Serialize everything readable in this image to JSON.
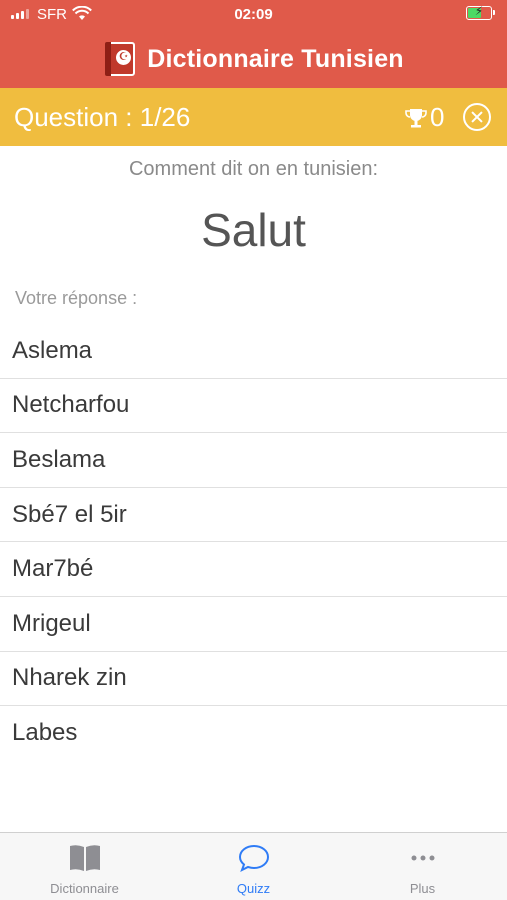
{
  "status_bar": {
    "carrier": "SFR",
    "time": "02:09"
  },
  "header": {
    "title": "Dictionnaire Tunisien",
    "icon": "app-book-flag-icon"
  },
  "question_bar": {
    "label": "Question : 1/26",
    "score": "0",
    "score_icon": "trophy-icon",
    "close_icon": "close-circle-icon"
  },
  "quiz": {
    "prompt": "Comment dit on en tunisien:",
    "word": "Salut",
    "answer_label": "Votre réponse :",
    "options": [
      "Aslema",
      "Netcharfou",
      "Beslama",
      "Sbé7 el 5ir",
      "Mar7bé",
      "Mrigeul",
      "Nharek zin",
      "Labes"
    ]
  },
  "tab_bar": {
    "tabs": [
      {
        "label": "Dictionnaire",
        "icon": "book-icon",
        "active": false
      },
      {
        "label": "Quizz",
        "icon": "chat-bubble-icon",
        "active": true
      },
      {
        "label": "Plus",
        "icon": "more-dots-icon",
        "active": false
      }
    ]
  },
  "colors": {
    "header": "#e05a4a",
    "question_bar": "#f0bd3f",
    "active_tab": "#2f7cf6"
  }
}
